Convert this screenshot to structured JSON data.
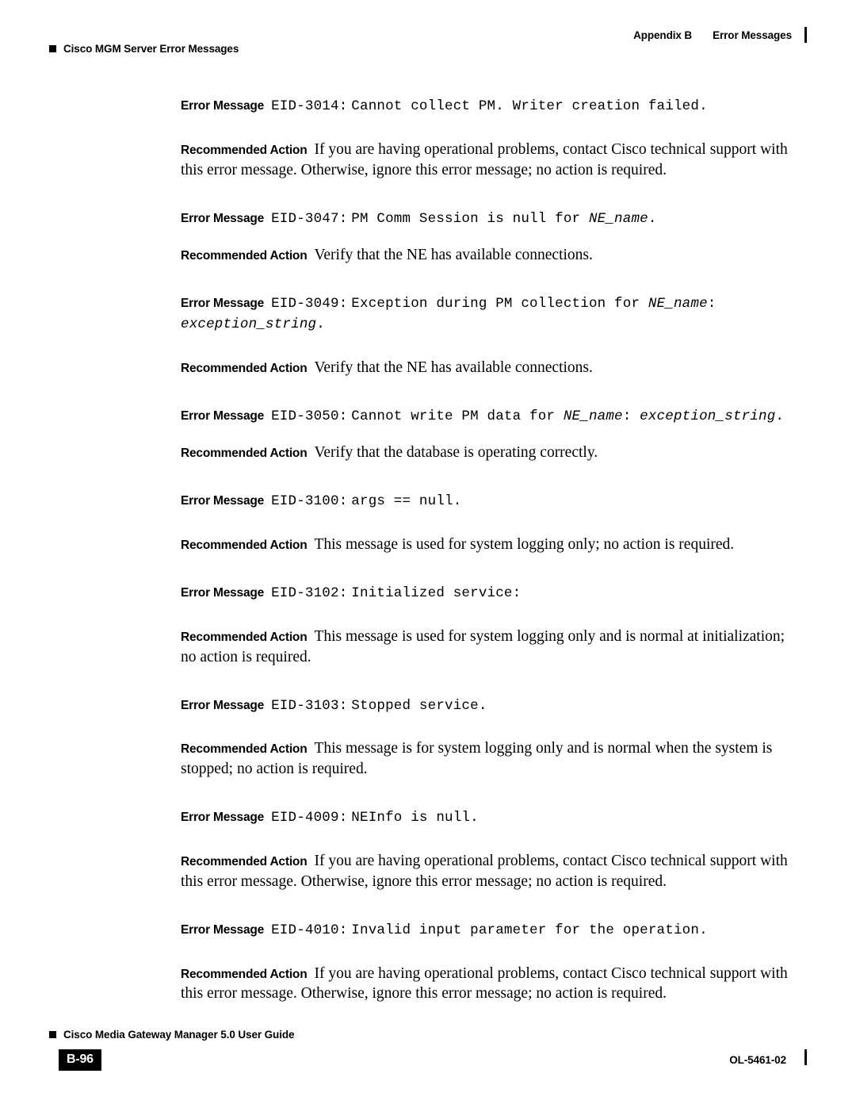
{
  "header": {
    "left_marker": "square-bullet",
    "left_text": "Cisco MGM Server Error Messages",
    "appendix": "Appendix B",
    "section": "Error Messages"
  },
  "labels": {
    "error_message": "Error Message",
    "recommended_action": "Recommended Action"
  },
  "entries": [
    {
      "id": "eid-3014",
      "code": "EID-3014:",
      "message": "Cannot collect PM. Writer creation failed.",
      "action": "If you are having operational problems, contact Cisco technical support with this error message. Otherwise, ignore this error message; no action is required."
    },
    {
      "id": "eid-3047",
      "code": "EID-3047:",
      "message_pre": "PM Comm Session is null for ",
      "message_var": "NE_name",
      "message_post": ".",
      "action": "Verify that the NE has available connections."
    },
    {
      "id": "eid-3049",
      "code": "EID-3049:",
      "message_pre": "Exception during PM collection for ",
      "message_var": "NE_name",
      "message_mid": ": ",
      "message_var2": "exception_string",
      "message_post": ".",
      "action": "Verify that the NE has available connections."
    },
    {
      "id": "eid-3050",
      "code": "EID-3050:",
      "message_pre": "Cannot write PM data for ",
      "message_var": "NE_name",
      "message_mid": ": ",
      "message_var2": "exception_string",
      "message_post": ".",
      "action": "Verify that the database is operating correctly."
    },
    {
      "id": "eid-3100",
      "code": "EID-3100:",
      "message": "args == null.",
      "action": "This message is used for system logging only; no action is required."
    },
    {
      "id": "eid-3102",
      "code": "EID-3102:",
      "message": "Initialized service:",
      "action": "This message is used for system logging only and is normal at initialization; no action is required."
    },
    {
      "id": "eid-3103",
      "code": "EID-3103:",
      "message": "Stopped service.",
      "action": "This message is for system logging only and is normal when the system is stopped; no action is required."
    },
    {
      "id": "eid-4009",
      "code": "EID-4009:",
      "message": "NEInfo is null.",
      "action": "If you are having operational problems, contact Cisco technical support with this error message. Otherwise, ignore this error message; no action is required."
    },
    {
      "id": "eid-4010",
      "code": "EID-4010:",
      "message": "Invalid input parameter for the operation.",
      "action": "If you are having operational problems, contact Cisco technical support with this error message. Otherwise, ignore this error message; no action is required."
    }
  ],
  "footer": {
    "guide_title": "Cisco Media Gateway Manager 5.0 User Guide",
    "page_number": "B-96",
    "doc_number": "OL-5461-02"
  }
}
